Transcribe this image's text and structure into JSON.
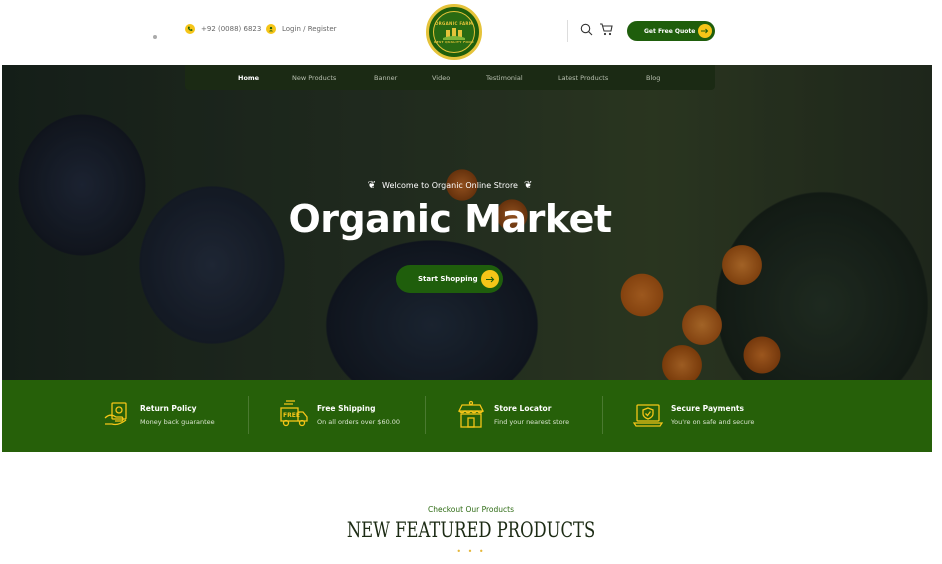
{
  "topbar": {
    "phone": "+92 (0088) 6823",
    "login": "Login / Register",
    "logo_text_top": "ORGANIC FARM",
    "logo_text_bottom": "BEST QUALITY FOOD",
    "quote_label": "Get Free Quote"
  },
  "nav": {
    "items": [
      {
        "label": "Home"
      },
      {
        "label": "New Products"
      },
      {
        "label": "Banner"
      },
      {
        "label": "Video"
      },
      {
        "label": "Testimonial"
      },
      {
        "label": "Latest Products"
      },
      {
        "label": "Blog"
      }
    ]
  },
  "hero": {
    "subtitle": "Welcome to Organic Online Strore",
    "title": "Organic Market",
    "cta": "Start Shopping"
  },
  "features": [
    {
      "title": "Return Policy",
      "subtitle": "Money back guarantee",
      "icon": "return-policy-icon"
    },
    {
      "title": "Free Shipping",
      "subtitle": "On all orders over $60.00",
      "icon": "free-shipping-icon"
    },
    {
      "title": "Store Locator",
      "subtitle": "Find your nearest store",
      "icon": "store-locator-icon"
    },
    {
      "title": "Secure Payments",
      "subtitle": "You're on safe and secure",
      "icon": "secure-payments-icon"
    }
  ],
  "featured": {
    "eyebrow": "Checkout Our Products",
    "title": "NEW FEATURED PRODUCTS"
  },
  "colors": {
    "primary_green": "#1f5e0c",
    "band_green": "#266009",
    "accent_yellow": "#f5c518"
  }
}
